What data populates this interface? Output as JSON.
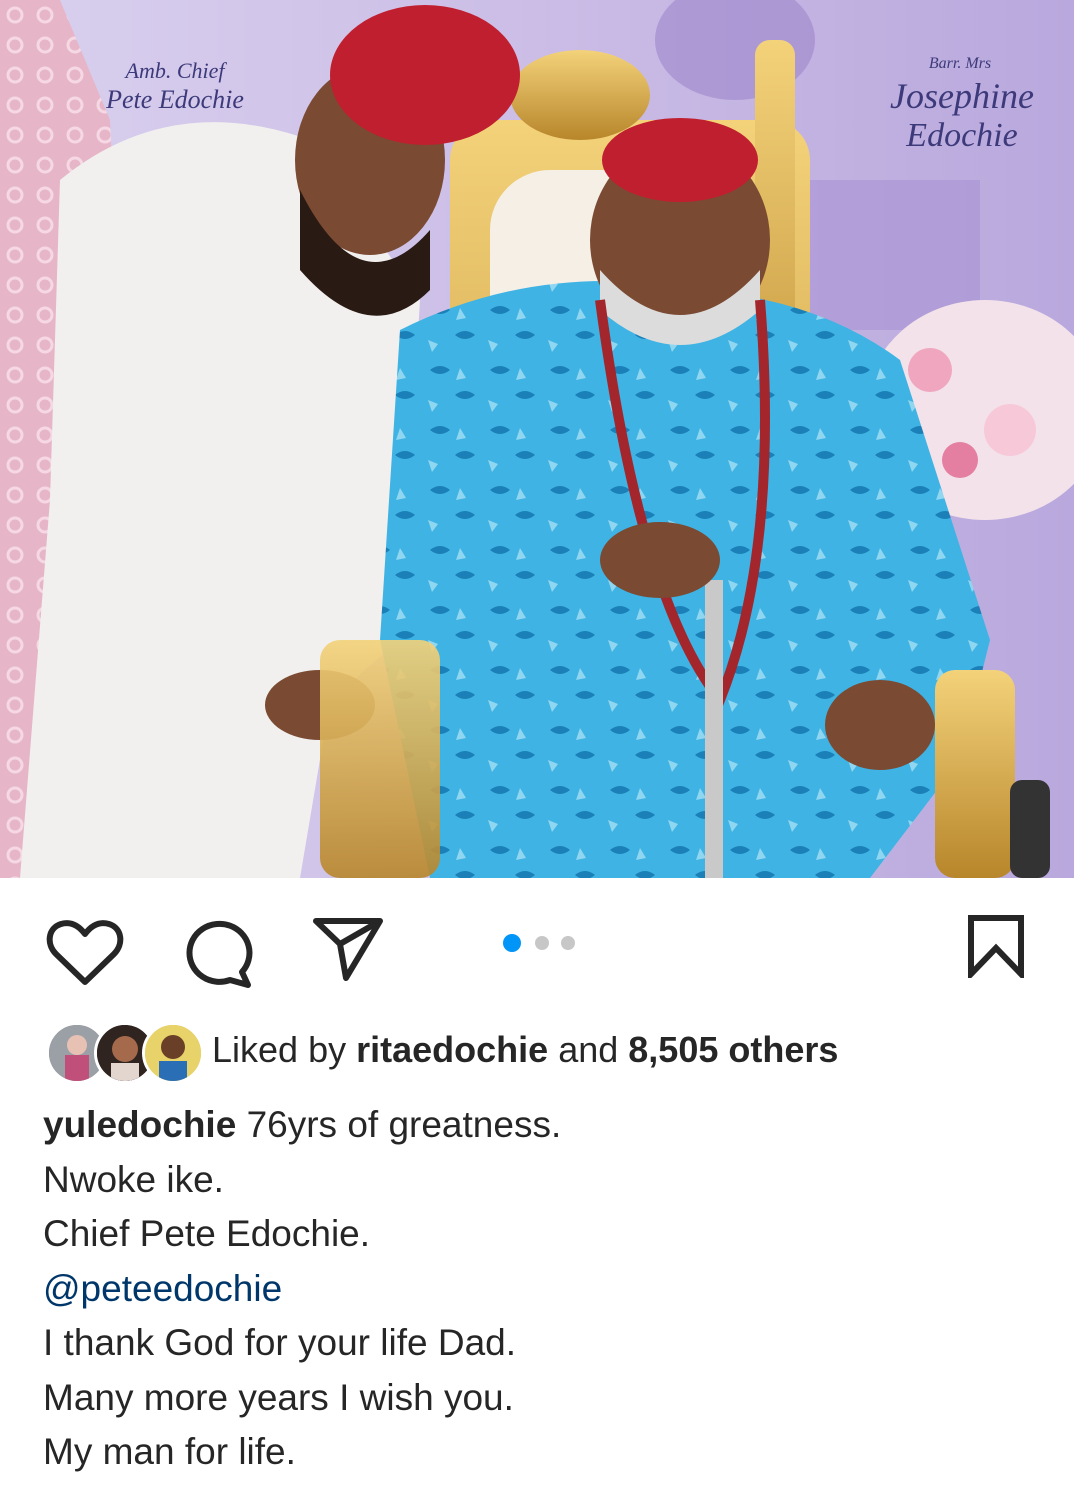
{
  "post_image": {
    "banner_left_line1": "Amb. Chief",
    "banner_left_line2": "Pete Edochie",
    "banner_right_line1": "Barr. Mrs",
    "banner_right_line2": "Josephine",
    "banner_right_line3": "Edochie"
  },
  "actions": {
    "like_icon": "heart-icon",
    "comment_icon": "comment-icon",
    "share_icon": "send-icon",
    "save_icon": "bookmark-icon"
  },
  "carousel": {
    "count": 3,
    "active_index": 0,
    "active_color": "#0095f6",
    "inactive_color": "#c7c7c7"
  },
  "likes": {
    "prefix": "Liked by",
    "liker": "ritaedochie",
    "conjunction": "and",
    "others": "8,505 others"
  },
  "caption": {
    "username": "yuledochie",
    "first_line": "76yrs of greatness.",
    "lines": [
      "Nwoke ike.",
      "Chief Pete Edochie."
    ],
    "mention": "@peteedochie",
    "more_lines": [
      "I thank God for your life Dad.",
      "Many more years I wish you.",
      "My man for life."
    ]
  },
  "colors": {
    "text": "#262626",
    "mention": "#00376b",
    "accent": "#0095f6"
  }
}
